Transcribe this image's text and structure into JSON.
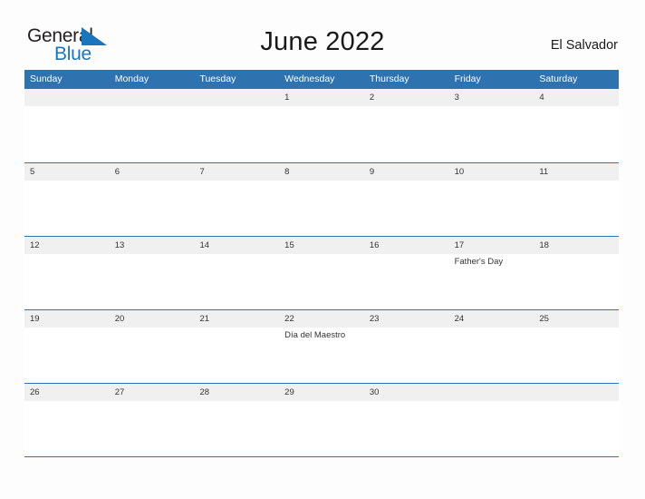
{
  "brand": {
    "name_part1": "General",
    "name_part2": "Blue",
    "mark_icon": "blue-triangle-flag-icon",
    "dark_color": "#231f20",
    "blue_color": "#1b75bc"
  },
  "header": {
    "title": "June 2022",
    "location": "El Salvador"
  },
  "theme": {
    "header_band": "#2e72b0",
    "row_divider": "#2e74b5",
    "date_strip": "#f0f0f0",
    "page_background": "#fdfdfd",
    "text": "#333333"
  },
  "calendar": {
    "month": "June",
    "year": "2022",
    "weekdays": [
      "Sunday",
      "Monday",
      "Tuesday",
      "Wednesday",
      "Thursday",
      "Friday",
      "Saturday"
    ],
    "weeks": [
      {
        "days": [
          {
            "date": "",
            "events": []
          },
          {
            "date": "",
            "events": []
          },
          {
            "date": "",
            "events": []
          },
          {
            "date": "1",
            "events": []
          },
          {
            "date": "2",
            "events": []
          },
          {
            "date": "3",
            "events": []
          },
          {
            "date": "4",
            "events": []
          }
        ]
      },
      {
        "days": [
          {
            "date": "5",
            "events": []
          },
          {
            "date": "6",
            "events": []
          },
          {
            "date": "7",
            "events": []
          },
          {
            "date": "8",
            "events": []
          },
          {
            "date": "9",
            "events": []
          },
          {
            "date": "10",
            "events": []
          },
          {
            "date": "11",
            "events": []
          }
        ]
      },
      {
        "days": [
          {
            "date": "12",
            "events": []
          },
          {
            "date": "13",
            "events": []
          },
          {
            "date": "14",
            "events": []
          },
          {
            "date": "15",
            "events": []
          },
          {
            "date": "16",
            "events": []
          },
          {
            "date": "17",
            "events": [
              "Father's Day"
            ]
          },
          {
            "date": "18",
            "events": []
          }
        ]
      },
      {
        "days": [
          {
            "date": "19",
            "events": []
          },
          {
            "date": "20",
            "events": []
          },
          {
            "date": "21",
            "events": []
          },
          {
            "date": "22",
            "events": [
              "Día del Maestro"
            ]
          },
          {
            "date": "23",
            "events": []
          },
          {
            "date": "24",
            "events": []
          },
          {
            "date": "25",
            "events": []
          }
        ]
      },
      {
        "days": [
          {
            "date": "26",
            "events": []
          },
          {
            "date": "27",
            "events": []
          },
          {
            "date": "28",
            "events": []
          },
          {
            "date": "29",
            "events": []
          },
          {
            "date": "30",
            "events": []
          },
          {
            "date": "",
            "events": []
          },
          {
            "date": "",
            "events": []
          }
        ]
      }
    ]
  }
}
